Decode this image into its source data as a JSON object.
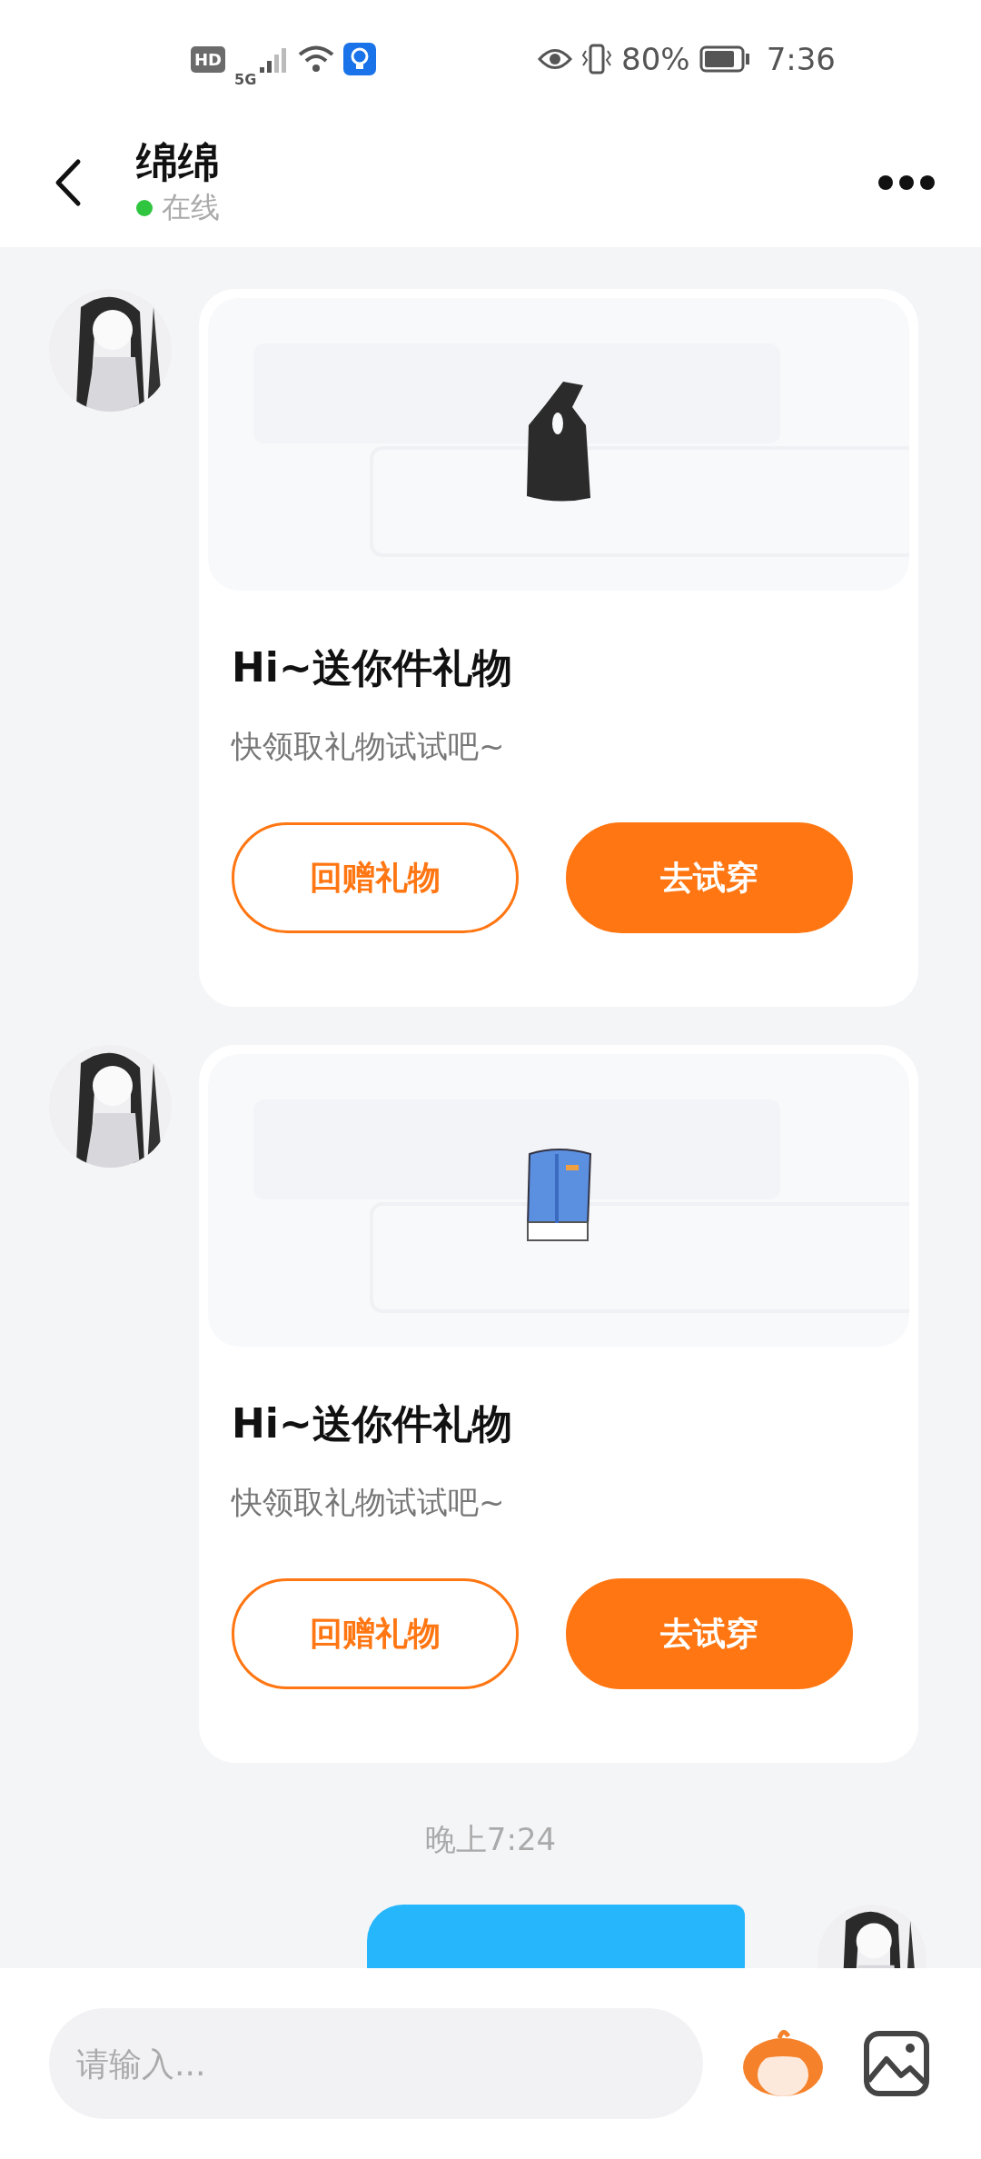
{
  "status_bar": {
    "left_badges": [
      "HD",
      "5G"
    ],
    "battery": "80%",
    "time": "7:36"
  },
  "header": {
    "name": "绵绵",
    "status": {
      "text": "在线",
      "online": true
    }
  },
  "messages": [
    {
      "kind": "gift",
      "title": "Hi~送你件礼物",
      "subtitle": "快领取礼物试试吧~",
      "buttons": [
        {
          "label": "回赠礼物",
          "kind": "outline"
        },
        {
          "label": "去试穿",
          "kind": "filled"
        }
      ]
    },
    {
      "kind": "gift",
      "title": "Hi~送你件礼物",
      "subtitle": "快领取礼物试试吧~",
      "buttons": [
        {
          "label": "回赠礼物",
          "kind": "outline"
        },
        {
          "label": "去试穿",
          "kind": "filled"
        }
      ]
    },
    {
      "kind": "time",
      "text": "晚上7:24"
    },
    {
      "kind": "outgoing"
    }
  ],
  "composer": {
    "placeholder": "请输入..."
  }
}
